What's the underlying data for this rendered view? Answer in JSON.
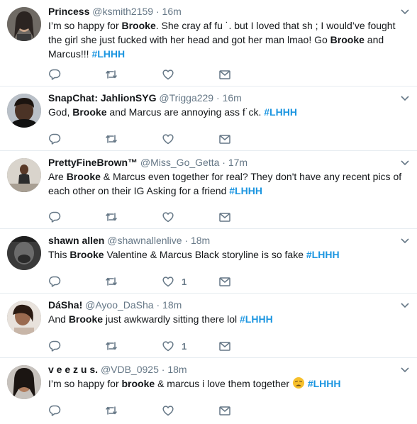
{
  "tweets": [
    {
      "name": "Princess",
      "handle": "@ksmith2159",
      "sep": "·",
      "time": "16m",
      "pre": "I’m so happy for ",
      "bold": "Brooke",
      "mid": ". She cray af fu ˙. but I loved that sh ; I would’ve fought the girl she just fucked with her head and got her man lmao! Go ",
      "bold2": "Brooke",
      "post": " and Marcus!!! ",
      "hashtag": "#LHHH",
      "likes": ""
    },
    {
      "name": "SnapChat: JahlionSYG",
      "handle": "@Trigga229",
      "sep": "·",
      "time": "16m",
      "pre": "God, ",
      "bold": "Brooke",
      "mid": " and Marcus are annoying ass f˙ck. ",
      "hashtag": "#LHHH",
      "likes": ""
    },
    {
      "name": "PrettyFineBrown™",
      "handle": "@Miss_Go_Getta",
      "sep": "·",
      "time": "17m",
      "pre": "Are ",
      "bold": "Brooke",
      "mid": " & Marcus even together for real? They don't have any recent pics of each other on their IG Asking for a friend ",
      "hashtag": "#LHHH",
      "likes": ""
    },
    {
      "name": "shawn allen",
      "handle": "@shawnallenlive",
      "sep": "·",
      "time": "18m",
      "pre": "This ",
      "bold": "Brooke",
      "mid": " Valentine & Marcus Black storyline is so fake ",
      "hashtag": "#LHHH",
      "likes": "1"
    },
    {
      "name": "DáSha!",
      "handle": "@Ayoo_DaSha",
      "sep": "·",
      "time": "18m",
      "pre": "And ",
      "bold": "Brooke",
      "mid": " just awkwardly sitting there lol ",
      "hashtag": "#LHHH",
      "likes": "1"
    },
    {
      "name": "v e e z u s.",
      "handle": "@VDB_0925",
      "sep": "·",
      "time": "18m",
      "pre": "I’m so happy for ",
      "bold": "brooke",
      "mid": " & marcus i love them together ",
      "emoji": "weary-face-emoji",
      "hashtag": "#LHHH",
      "likes": ""
    }
  ],
  "icons": {
    "reply": "reply-icon",
    "retweet": "retweet-icon",
    "like": "heart-icon",
    "message": "envelope-icon",
    "menu": "chevron-down-icon"
  },
  "colors": {
    "hashtag": "#1b95e0",
    "secondary": "#657786",
    "divider": "#e6ecf0"
  }
}
